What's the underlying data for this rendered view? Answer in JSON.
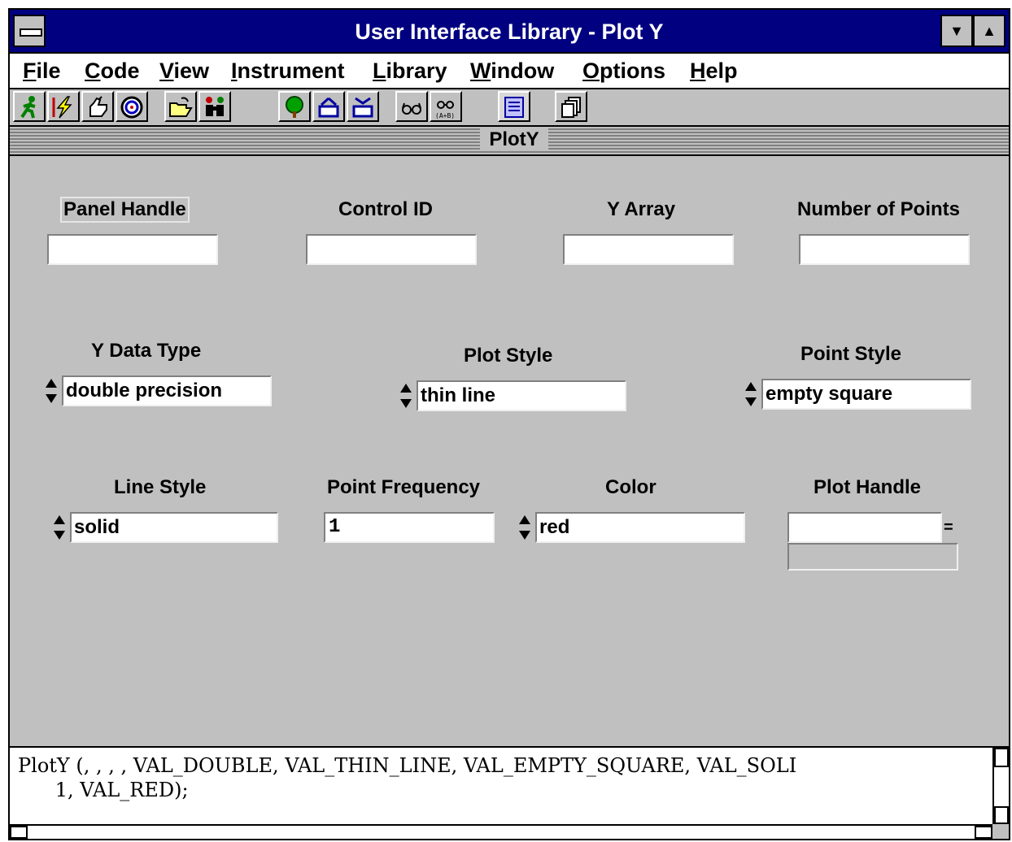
{
  "window": {
    "title": "User Interface Library - Plot Y"
  },
  "menu": {
    "items": [
      "File",
      "Code",
      "View",
      "Instrument",
      "Library",
      "Window",
      "Options",
      "Help"
    ]
  },
  "toolbar": {
    "icons": [
      "run-icon",
      "lightning-icon",
      "hand-icon",
      "target-icon",
      "open-folder-icon",
      "binoculars-icon",
      "tree-icon",
      "panel-up-icon",
      "panel-down-icon",
      "glasses-icon",
      "glasses-ab-icon",
      "function-panel-icon",
      "windows-icon"
    ]
  },
  "panel": {
    "header": "PlotY"
  },
  "fields": {
    "panel_handle": {
      "label": "Panel Handle",
      "value": ""
    },
    "control_id": {
      "label": "Control ID",
      "value": ""
    },
    "y_array": {
      "label": "Y Array",
      "value": ""
    },
    "number_of_points": {
      "label": "Number of Points",
      "value": ""
    },
    "y_data_type": {
      "label": "Y Data Type",
      "value": "double precision"
    },
    "plot_style": {
      "label": "Plot Style",
      "value": "thin line"
    },
    "point_style": {
      "label": "Point Style",
      "value": "empty square"
    },
    "line_style": {
      "label": "Line Style",
      "value": "solid"
    },
    "point_frequency": {
      "label": "Point Frequency",
      "value": "1"
    },
    "color": {
      "label": "Color",
      "value": "red"
    },
    "plot_handle": {
      "label": "Plot Handle",
      "value": "",
      "equals": "="
    }
  },
  "code": {
    "line1": "PlotY (, , , , VAL_DOUBLE, VAL_THIN_LINE, VAL_EMPTY_SQUARE, VAL_SOLI",
    "line2": "      1, VAL_RED);"
  },
  "colors": {
    "titlebar": "#000080",
    "panel": "#c0c0c0"
  }
}
